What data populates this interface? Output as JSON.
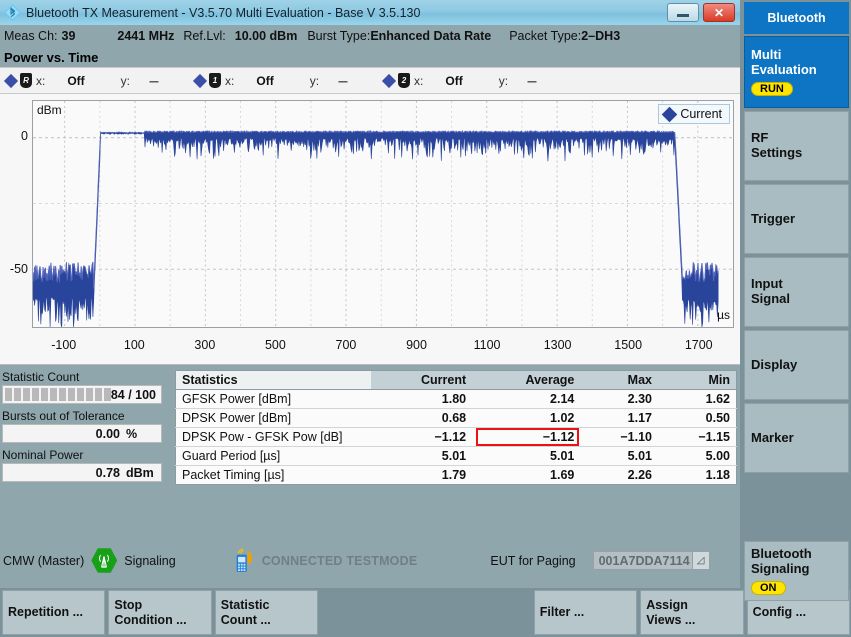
{
  "window": {
    "icon": "bluetooth-icon",
    "title": "Bluetooth TX Measurement  - V3.5.70 Multi Evaluation - Base V 3.5.130",
    "minimize_label": "minimize",
    "close_label": "✕"
  },
  "meas_header": {
    "channel_label": "Meas Ch:",
    "channel_value": "39",
    "frequency_value": "2441 MHz",
    "reflvl_label": "Ref.Lvl:",
    "reflvl_value": "10.00 dBm",
    "bursttype_label": "Burst Type:",
    "bursttype_value": "Enhanced Data Rate",
    "packettype_label": "Packet Type:",
    "packettype_value": "2–DH3"
  },
  "panel": {
    "title": "Power vs. Time"
  },
  "markers": [
    {
      "tag": "R",
      "x_label": "x:",
      "x_value": "Off",
      "y_label": "y:",
      "y_value": "---"
    },
    {
      "tag": "1",
      "x_label": "x:",
      "x_value": "Off",
      "y_label": "y:",
      "y_value": "---"
    },
    {
      "tag": "2",
      "x_label": "x:",
      "x_value": "Off",
      "y_label": "y:",
      "y_value": "---"
    }
  ],
  "chart_data": {
    "type": "line",
    "title": "Power vs. Time",
    "xlabel": "µs",
    "ylabel": "dBm",
    "xlim": [
      -190,
      1800
    ],
    "ylim": [
      -72,
      14
    ],
    "xticks": [
      -100,
      100,
      300,
      500,
      700,
      900,
      1100,
      1300,
      1500,
      1700
    ],
    "yticks": [
      0,
      -50
    ],
    "grid": true,
    "legend": {
      "position": "top-right",
      "entries": [
        "Current"
      ]
    },
    "series": [
      {
        "name": "Current",
        "color": "#29449b",
        "description": "Bluetooth EDR 2-DH3 burst power envelope",
        "segments": [
          {
            "region": "noise-floor-leading",
            "x_start": -190,
            "x_end": -18,
            "level": -55,
            "spread": 14
          },
          {
            "region": "rising-edge",
            "x_start": -18,
            "x_end": 2,
            "level_start": -60,
            "level_end": 1
          },
          {
            "region": "gfsk-access-header",
            "x_start": 2,
            "x_end": 128,
            "level": 1.8,
            "spread": 0.4
          },
          {
            "region": "dpsk-payload",
            "x_start": 128,
            "x_end": 1635,
            "level": 0.68,
            "spread": 7.5
          },
          {
            "region": "falling-edge",
            "x_start": 1635,
            "x_end": 1655,
            "level_start": 0.5,
            "level_end": -52
          },
          {
            "region": "noise-floor-trailing",
            "x_start": 1655,
            "x_end": 1760,
            "level": -55,
            "spread": 14
          }
        ]
      }
    ]
  },
  "left_stats": {
    "statistic_count_label": "Statistic Count",
    "statistic_count_value": "84 / 100",
    "statistic_count_current": 84,
    "statistic_count_total": 100,
    "bursts_label": "Bursts out of Tolerance",
    "bursts_value": "0.00",
    "bursts_unit": "%",
    "nominal_label": "Nominal Power",
    "nominal_value": "0.78",
    "nominal_unit": "dBm"
  },
  "stats_table": {
    "headers": [
      "Statistics",
      "Current",
      "Average",
      "Max",
      "Min"
    ],
    "rows": [
      {
        "name": "GFSK Power [dBm]",
        "current": "1.80",
        "average": "2.14",
        "max": "2.30",
        "min": "1.62"
      },
      {
        "name": "DPSK Power [dBm]",
        "current": "0.68",
        "average": "1.02",
        "max": "1.17",
        "min": "0.50"
      },
      {
        "name": "DPSK Pow - GFSK Pow [dB]",
        "current": "−1.12",
        "average": "−1.12",
        "max": "−1.10",
        "min": "−1.15"
      },
      {
        "name": "Guard Period [µs]",
        "current": "5.01",
        "average": "5.01",
        "max": "5.01",
        "min": "5.00"
      },
      {
        "name": "Packet Timing [µs]",
        "current": "1.79",
        "average": "1.69",
        "max": "2.26",
        "min": "1.18"
      }
    ],
    "highlight": {
      "row": 2,
      "column": "average",
      "color": "#ee1111"
    }
  },
  "statusbar": {
    "device_label": "CMW (Master)",
    "antenna_icon": "antenna-tower-icon",
    "signaling_label": "Signaling",
    "phone_icon": "mobile-phone-icon",
    "connection_state": "CONNECTED TESTMODE",
    "eut_label": "EUT for Paging",
    "eut_value": "001A7DDA7114",
    "eut_button_icon": "edit-icon"
  },
  "toolbar": [
    {
      "label": "Repetition ...",
      "enabled": true
    },
    {
      "label": "Stop\nCondition ...",
      "line1": "Stop",
      "line2": "Condition ...",
      "enabled": true
    },
    {
      "label": "Statistic\nCount ...",
      "line1": "Statistic",
      "line2": "Count ...",
      "enabled": true
    },
    {
      "label": "",
      "enabled": false
    },
    {
      "label": "",
      "enabled": false
    },
    {
      "label": "Filter ...",
      "enabled": true
    },
    {
      "label": "Assign\nViews ...",
      "line1": "Assign",
      "line2": "Views ...",
      "enabled": true
    },
    {
      "label": "Config ...",
      "enabled": true
    }
  ],
  "sidebar": {
    "header": "Bluetooth",
    "items": [
      {
        "line1": "Multi",
        "line2": "Evaluation",
        "badge": "RUN",
        "active": true
      },
      {
        "line1": "RF",
        "line2": "Settings",
        "active": false
      },
      {
        "line1": "Trigger",
        "line2": "",
        "active": false
      },
      {
        "line1": "Input",
        "line2": "Signal",
        "active": false
      },
      {
        "line1": "Display",
        "line2": "",
        "active": false
      },
      {
        "line1": "Marker",
        "line2": "",
        "active": false
      }
    ],
    "footer": {
      "line1": "Bluetooth",
      "line2": "Signaling",
      "badge": "ON"
    }
  },
  "colors": {
    "accent_blue": "#0d75c4",
    "trace_blue": "#29449b",
    "panel_bg": "#8fa6ad",
    "badge_yellow": "#ffe400",
    "highlight_red": "#ee1111",
    "connected_green": "#18a018"
  }
}
